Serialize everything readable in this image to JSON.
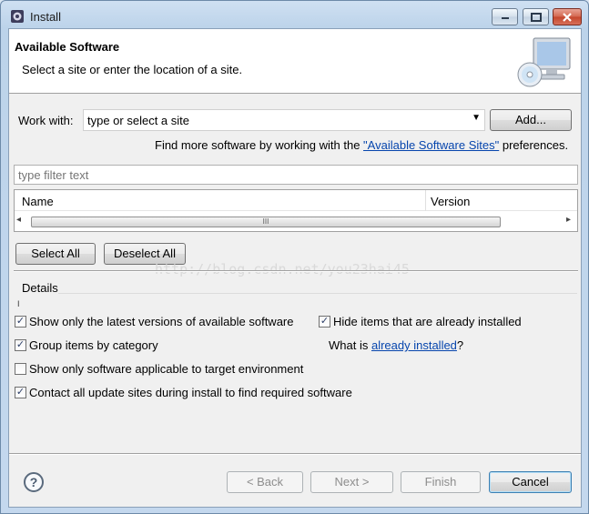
{
  "window": {
    "title": "Install"
  },
  "header": {
    "title": "Available Software",
    "description": "Select a site or enter the location of a site."
  },
  "work_with": {
    "label": "Work with:",
    "combo_value": "type or select a site",
    "add_button": "Add..."
  },
  "find_more": {
    "prefix": "Find more software by working with the ",
    "link": "\"Available Software Sites\"",
    "suffix": " preferences."
  },
  "filter": {
    "placeholder": "type filter text"
  },
  "tree": {
    "columns": [
      "Name",
      "Version"
    ],
    "scroll_grip": "III"
  },
  "buttons": {
    "select_all": "Select All",
    "deselect_all": "Deselect All"
  },
  "watermark": "http://blog.csdn.net/you23hai45",
  "details": {
    "label": "Details",
    "marker": "I"
  },
  "options": {
    "latest_versions": {
      "label": "Show only the latest versions of available software",
      "checked": true
    },
    "hide_installed": {
      "label": "Hide items that are already installed",
      "checked": true
    },
    "group_by_category": {
      "label": "Group items by category",
      "checked": true
    },
    "applicable_only": {
      "label": "Show only software applicable to target environment",
      "checked": false
    },
    "contact_sites": {
      "label": "Contact all update sites during install to find required software",
      "checked": true
    }
  },
  "already_installed": {
    "prefix": "What is ",
    "link": "already installed",
    "suffix": "?"
  },
  "footer": {
    "help_glyph": "?",
    "back": "< Back",
    "next": "Next >",
    "finish": "Finish",
    "cancel": "Cancel"
  },
  "glyphs": {
    "check": "✓",
    "dropdown": "▼",
    "scroll_left": "◂",
    "scroll_right": "▸"
  }
}
